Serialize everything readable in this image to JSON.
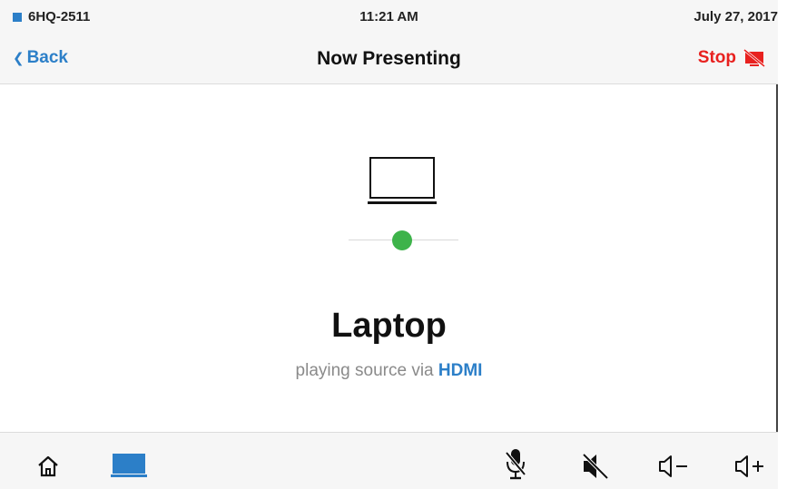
{
  "status": {
    "room": "6HQ-2511",
    "time": "11:21 AM",
    "date": "July 27, 2017",
    "room_color": "#2c7fc8"
  },
  "nav": {
    "back_label": "Back",
    "title": "Now Presenting",
    "stop_label": "Stop",
    "stop_color": "#e8211f"
  },
  "source": {
    "name": "Laptop",
    "subtitle_prefix": "playing source via",
    "connection": "HDMI",
    "icon": "laptop-icon",
    "status_color": "#3db34a"
  },
  "bottom": {
    "items": [
      {
        "icon": "home-icon"
      },
      {
        "icon": "laptop-source-icon",
        "selected": true
      },
      {
        "icon": "mic-mute-icon"
      },
      {
        "icon": "speaker-mute-icon"
      },
      {
        "icon": "volume-down-icon"
      },
      {
        "icon": "volume-up-icon"
      }
    ]
  }
}
